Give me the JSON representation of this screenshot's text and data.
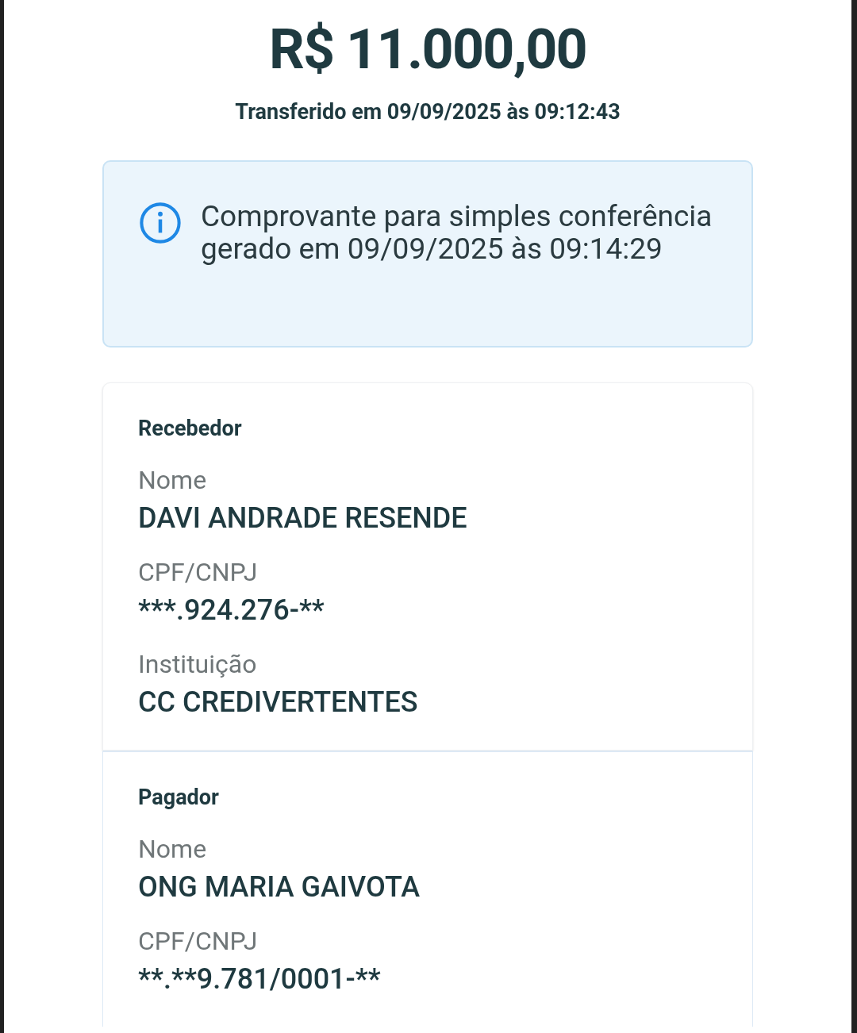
{
  "amount": "R$ 11.000,00",
  "transfer_time": "Transferido em 09/09/2025 às 09:12:43",
  "notice": {
    "text": "Comprovante para simples conferência gerado em 09/09/2025 às 09:14:29"
  },
  "sections": [
    {
      "title": "Recebedor",
      "fields": [
        {
          "label": "Nome",
          "value": "DAVI ANDRADE RESENDE"
        },
        {
          "label": "CPF/CNPJ",
          "value": "***.924.276-**"
        },
        {
          "label": "Instituição",
          "value": "CC CREDIVERTENTES"
        }
      ]
    },
    {
      "title": "Pagador",
      "fields": [
        {
          "label": "Nome",
          "value": "ONG MARIA GAIVOTA"
        },
        {
          "label": "CPF/CNPJ",
          "value": "**.**9.781/0001-**"
        }
      ]
    }
  ]
}
